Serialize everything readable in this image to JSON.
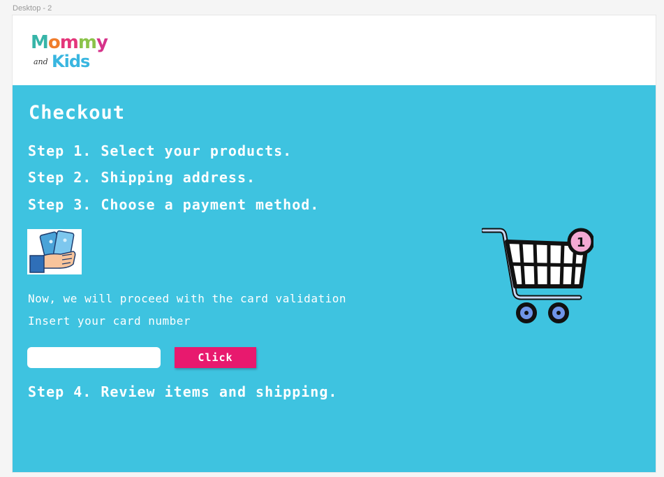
{
  "canvas": {
    "frame_label": "Desktop - 2"
  },
  "header": {
    "logo": {
      "word1_letters": [
        "M",
        "o",
        "m",
        "m",
        "y"
      ],
      "word1_colors": [
        "#37b5a8",
        "#f07d2c",
        "#e4367a",
        "#8bc34a",
        "#d6338a"
      ],
      "connector": "and",
      "word2": "Kids"
    }
  },
  "checkout": {
    "title": "Checkout",
    "step1": "Step 1. Select your products.",
    "step2": "Step 2. Shipping address.",
    "step3": "Step 3. Choose a payment method.",
    "proceed_text": "Now, we will proceed with the card validation",
    "insert_text": "Insert your card number",
    "card_input": {
      "value": "",
      "placeholder": ""
    },
    "click_label": "Click",
    "step4": "Step 4. Review items and shipping.",
    "cart_badge": "1"
  },
  "colors": {
    "main_bg": "#3ec3e0",
    "button_bg": "#e8196e",
    "text": "#ffffff"
  },
  "icons": {
    "payment": "hand-holding-cards-icon",
    "cart": "shopping-cart-icon"
  }
}
